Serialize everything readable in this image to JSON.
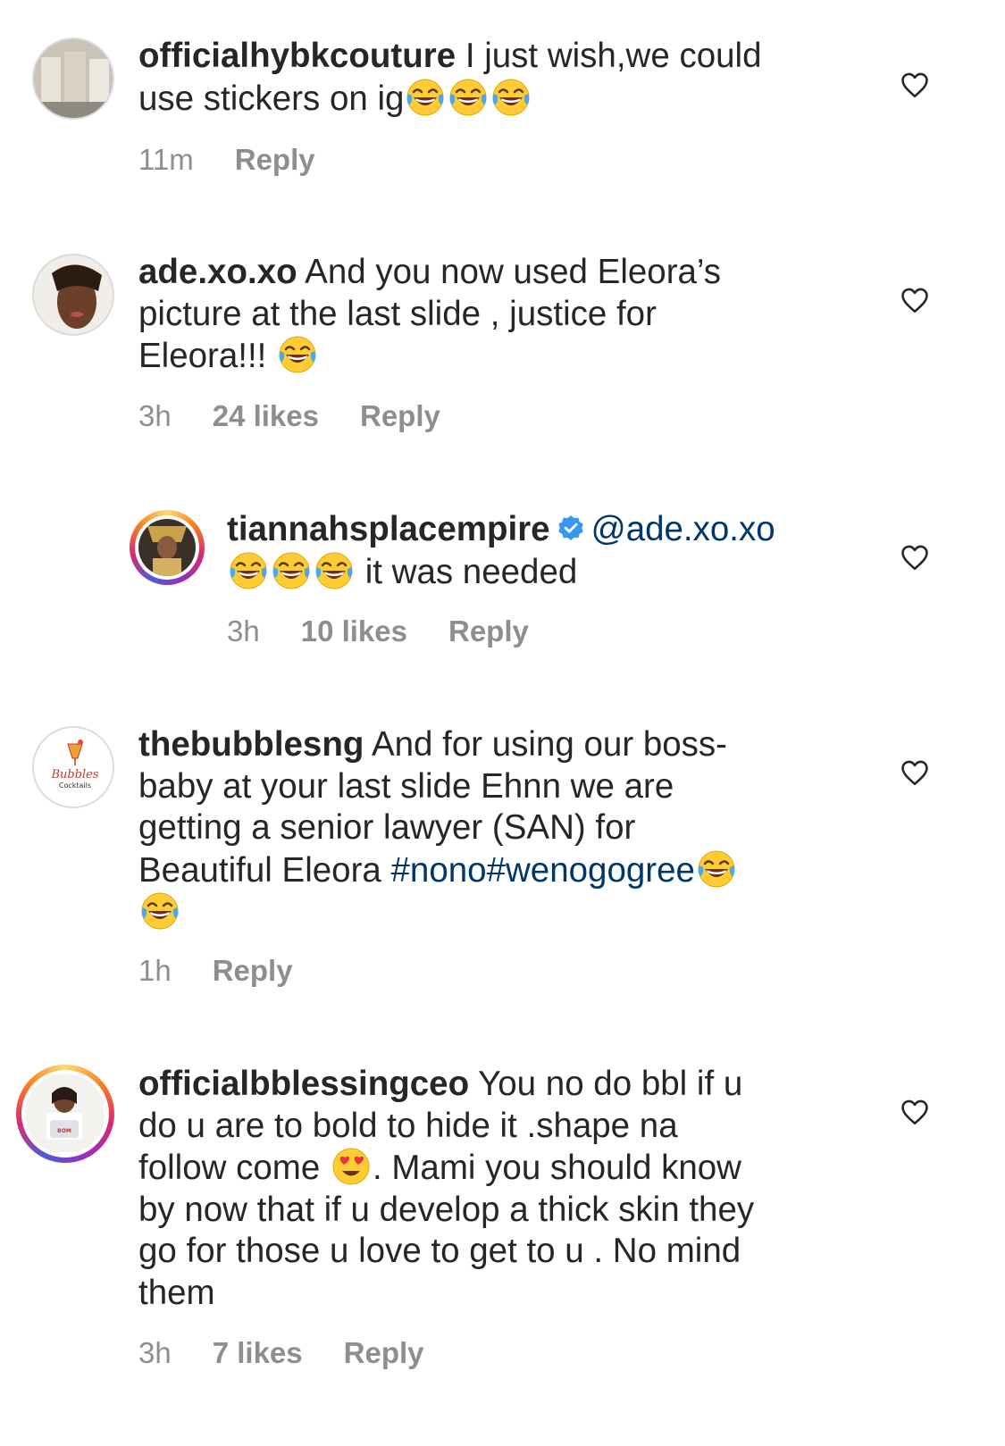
{
  "comments": [
    {
      "username": "officialhybkcouture",
      "line1_text": " I just wish,we could",
      "line2_text": "use stickers on ig",
      "time": "11m",
      "reply_label": "Reply"
    },
    {
      "username": "ade.xo.xo",
      "line1_text": " And you now used Eleora’s",
      "line2_text": "picture at the last slide , justice for",
      "line3_text": "Eleora!!! ",
      "time": "3h",
      "likes": "24 likes",
      "reply_label": "Reply"
    },
    {
      "username": "tiannahsplacempire",
      "mention": "@ade.xo.xo",
      "line2_text": " it was needed",
      "time": "3h",
      "likes": "10 likes",
      "reply_label": "Reply"
    },
    {
      "username": "thebubblesng",
      "line1_text": " And for using our boss-",
      "line2_text": "baby at your last slide Ehnn we are",
      "line3_text": "getting a senior lawyer (SAN) for",
      "line4_text": "Beautiful Eleora ",
      "hashtags": "#nono#wenogogree",
      "logo_text_1": "Bubbles",
      "logo_text_2": "Cocktails",
      "time": "1h",
      "reply_label": "Reply"
    },
    {
      "username": "officialbblessingceo",
      "line1_text": " You no do bbl if u",
      "line2_text": "do u are to bold to hide it .shape na",
      "line3a_text": "follow come ",
      "line3b_text": ". Mami you should know",
      "line4_text": "by now that if u develop a thick skin they",
      "line5_text": "go for those u love to get to u . No mind",
      "line6_text": "them",
      "laptop_text": "BOM",
      "time": "3h",
      "likes": "7 likes",
      "reply_label": "Reply"
    }
  ],
  "icons": {
    "like": "heart-outline-icon",
    "laugh": "tears-of-joy-emoji",
    "love": "heart-eyes-emoji",
    "verified": "verified-badge-icon"
  },
  "colors": {
    "text": "#262626",
    "meta": "#8e8e8e",
    "link": "#00376b",
    "verified": "#3897f0"
  }
}
